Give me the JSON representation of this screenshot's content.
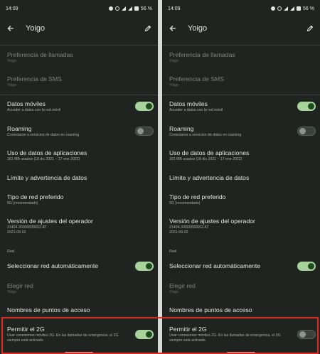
{
  "status": {
    "time": "14:09",
    "battery": "56 %"
  },
  "appbar": {
    "title": "Yoigo"
  },
  "items": {
    "call_pref": {
      "title": "Preferencia de llamadas",
      "sub": "Yoigo"
    },
    "sms_pref": {
      "title": "Preferencia de SMS",
      "sub": "Yoigo"
    },
    "mobile_data": {
      "title": "Datos móviles",
      "sub": "Acceder a datos con la red móvil",
      "on": true
    },
    "roaming": {
      "title": "Roaming",
      "sub": "Conectarse a servicios de datos en roaming",
      "on": false
    },
    "app_data": {
      "title": "Uso de datos de aplicaciones",
      "sub": "181 MB usados (18 dic 2021 – 17 ene 2022)"
    },
    "data_limit": {
      "title": "Límite y advertencia de datos"
    },
    "network_type": {
      "title": "Tipo de red preferido",
      "sub": "5G (recomendado)"
    },
    "carrier_version": {
      "title": "Versión de ajustes del operador",
      "sub": "21404-30000000652.AT",
      "sub2": "2021-09-02"
    },
    "section_red": "Red",
    "auto_network": {
      "title": "Seleccionar red automáticamente",
      "on": true
    },
    "choose_network": {
      "title": "Elegir red",
      "sub": "Yoigo"
    },
    "apn": {
      "title": "Nombres de puntos de acceso"
    },
    "allow_2g": {
      "title": "Permitir el 2G",
      "sub": "Usar conexiones móviles 2G. En las llamadas de emergencia, el 2G",
      "sub2": "siempre está activado.",
      "on_left": true,
      "on_right": false
    }
  }
}
